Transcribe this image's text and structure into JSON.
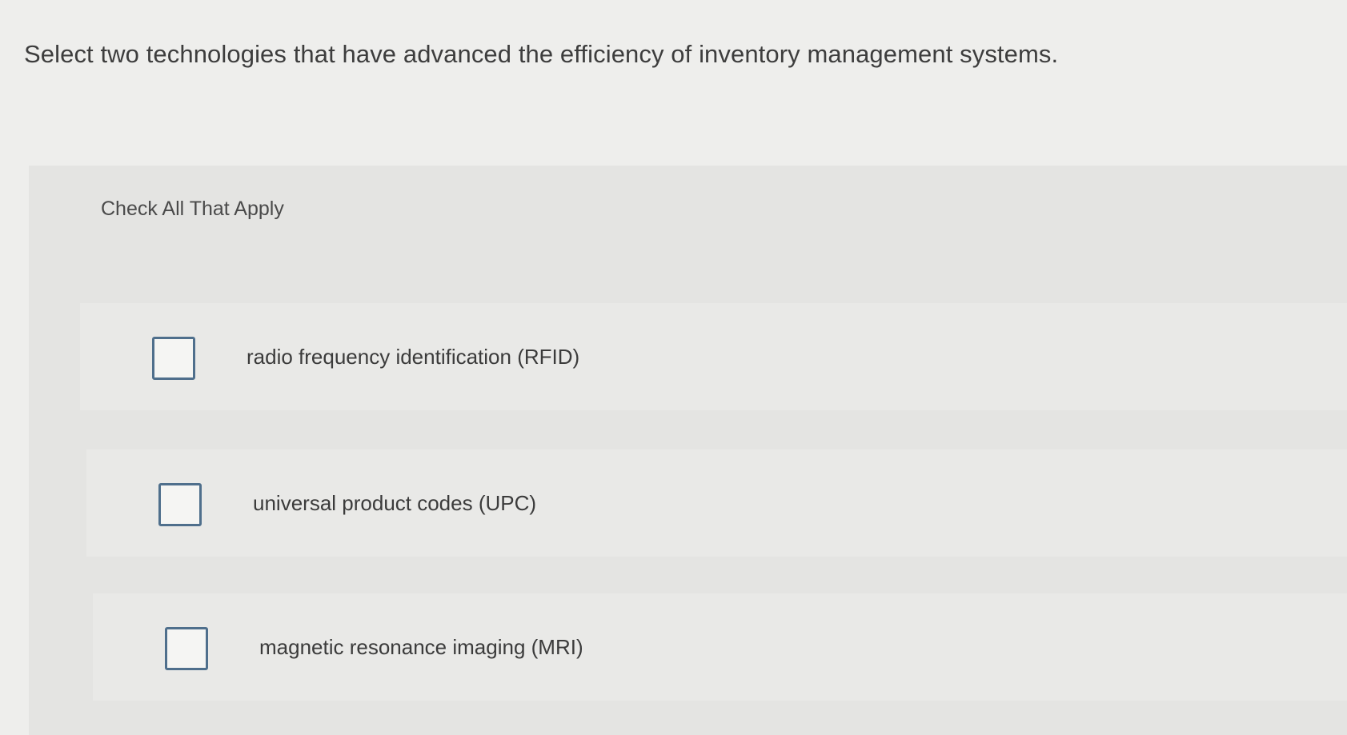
{
  "question": {
    "text": "Select two technologies that have advanced the efficiency of inventory management systems."
  },
  "panel": {
    "instruction": "Check All That Apply",
    "options": [
      {
        "label": "radio frequency identification (RFID)",
        "checked": false
      },
      {
        "label": "universal product codes (UPC)",
        "checked": false
      },
      {
        "label": "magnetic resonance imaging (MRI)",
        "checked": false
      }
    ]
  },
  "colors": {
    "checkbox_border": "#4f6f8c",
    "panel_background": "#e4e4e2",
    "option_background": "#e9e9e7"
  }
}
